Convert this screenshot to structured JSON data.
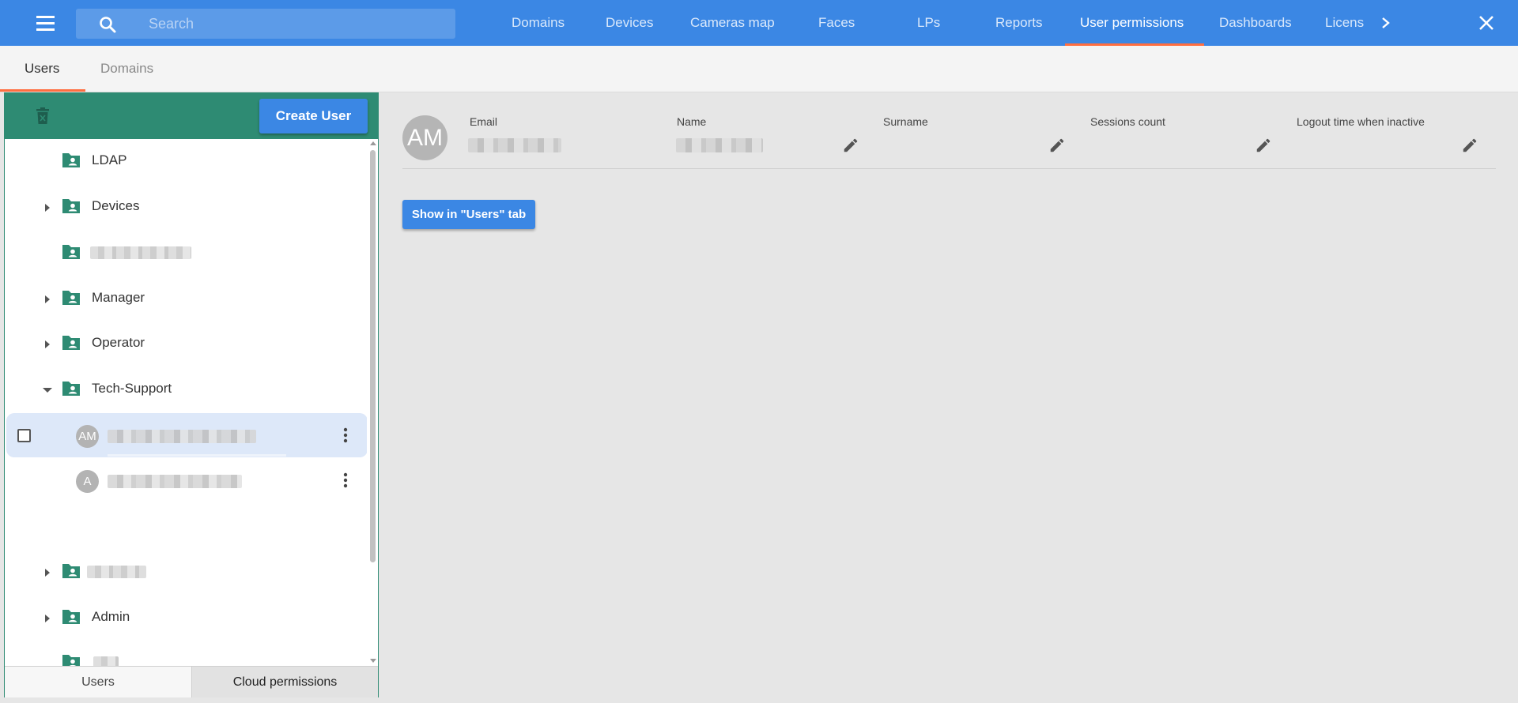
{
  "topbar": {
    "search_placeholder": "Search",
    "tabs": [
      {
        "label": "Domains"
      },
      {
        "label": "Devices"
      },
      {
        "label": "Cameras map"
      },
      {
        "label": "Faces"
      },
      {
        "label": "LPs"
      },
      {
        "label": "Reports"
      },
      {
        "label": "User permissions",
        "active": true
      },
      {
        "label": "Dashboards"
      },
      {
        "label": "Licens"
      }
    ],
    "accent_color": "#ff6e40",
    "bar_color": "#3b87e4"
  },
  "subtabs": {
    "users": "Users",
    "domains": "Domains",
    "active": "Users"
  },
  "left_panel": {
    "header_color": "#2e8b73",
    "create_user_label": "Create User",
    "tree": [
      {
        "label": "LDAP",
        "expandable": false
      },
      {
        "label": "Devices",
        "expandable": true,
        "expanded": false
      },
      {
        "label": "",
        "redacted": true,
        "expandable": false
      },
      {
        "label": "Manager",
        "expandable": true,
        "expanded": false
      },
      {
        "label": "Operator",
        "expandable": true,
        "expanded": false
      },
      {
        "label": "Tech-Support",
        "expandable": true,
        "expanded": true
      },
      {
        "label": "",
        "redacted": true,
        "expandable": true,
        "expanded": false
      },
      {
        "label": "Admin",
        "expandable": true,
        "expanded": false
      },
      {
        "label": "",
        "redacted": true,
        "expandable": false
      },
      {
        "label": "",
        "redacted": true,
        "expandable": true,
        "expanded": true
      }
    ],
    "users": [
      {
        "initials": "AM",
        "selected": true,
        "name_redacted": true
      },
      {
        "initials": "A",
        "selected": false,
        "name_redacted": true
      }
    ],
    "bottom_tabs": {
      "users": "Users",
      "cloud_permissions": "Cloud permissions"
    }
  },
  "details": {
    "avatar_initials": "AM",
    "fields": {
      "email": "Email",
      "name": "Name",
      "surname": "Surname",
      "sessions_count": "Sessions count",
      "logout_time": "Logout time when inactive"
    },
    "show_button_label": "Show in \"Users\" tab"
  },
  "icons": [
    "menu-icon",
    "search-icon",
    "chevron-right-icon",
    "close-icon",
    "trash-icon",
    "folder-user-icon",
    "caret-right-icon",
    "caret-down-icon",
    "more-vert-icon",
    "pencil-icon"
  ]
}
